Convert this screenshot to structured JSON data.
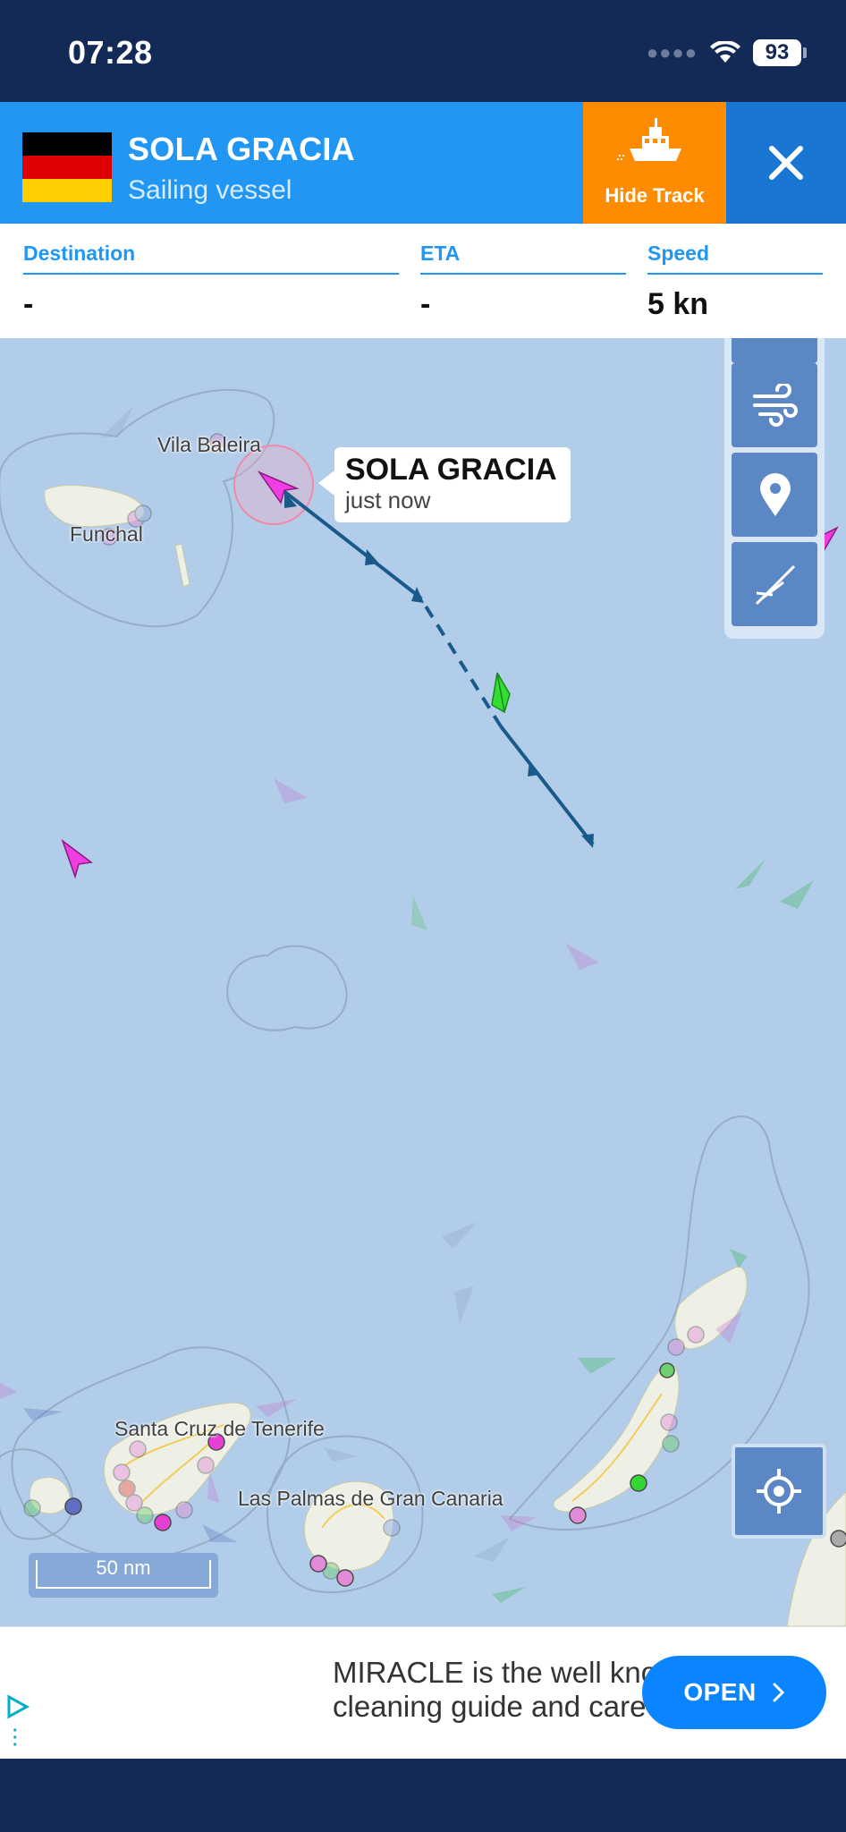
{
  "status": {
    "time": "07:28",
    "battery": "93"
  },
  "vessel": {
    "name": "SOLA GRACIA",
    "type": "Sailing vessel",
    "flag": "germany-flag",
    "hide_track_label": "Hide Track",
    "colors": {
      "header": "#2196f3",
      "hide_track": "#ff8c00",
      "close": "#1976d2"
    }
  },
  "info": {
    "destination": {
      "label": "Destination",
      "value": "-"
    },
    "eta": {
      "label": "ETA",
      "value": "-"
    },
    "speed": {
      "label": "Speed",
      "value": "5 kn"
    }
  },
  "map": {
    "callout": {
      "name": "SOLA GRACIA",
      "time": "just now"
    },
    "places": [
      "Vila Baleira",
      "Funchal",
      "Santa Cruz de Tenerife",
      "Las Palmas de Gran Canaria"
    ],
    "scale": "50 nm",
    "tools": [
      "layers-icon",
      "wind-icon",
      "pin-icon",
      "measure-icon"
    ],
    "track_color": "#1a5a8a"
  },
  "ad": {
    "text_line1": "MIRACLE is the well known",
    "text_line2": "cleaning guide and care guide",
    "button": "OPEN"
  }
}
